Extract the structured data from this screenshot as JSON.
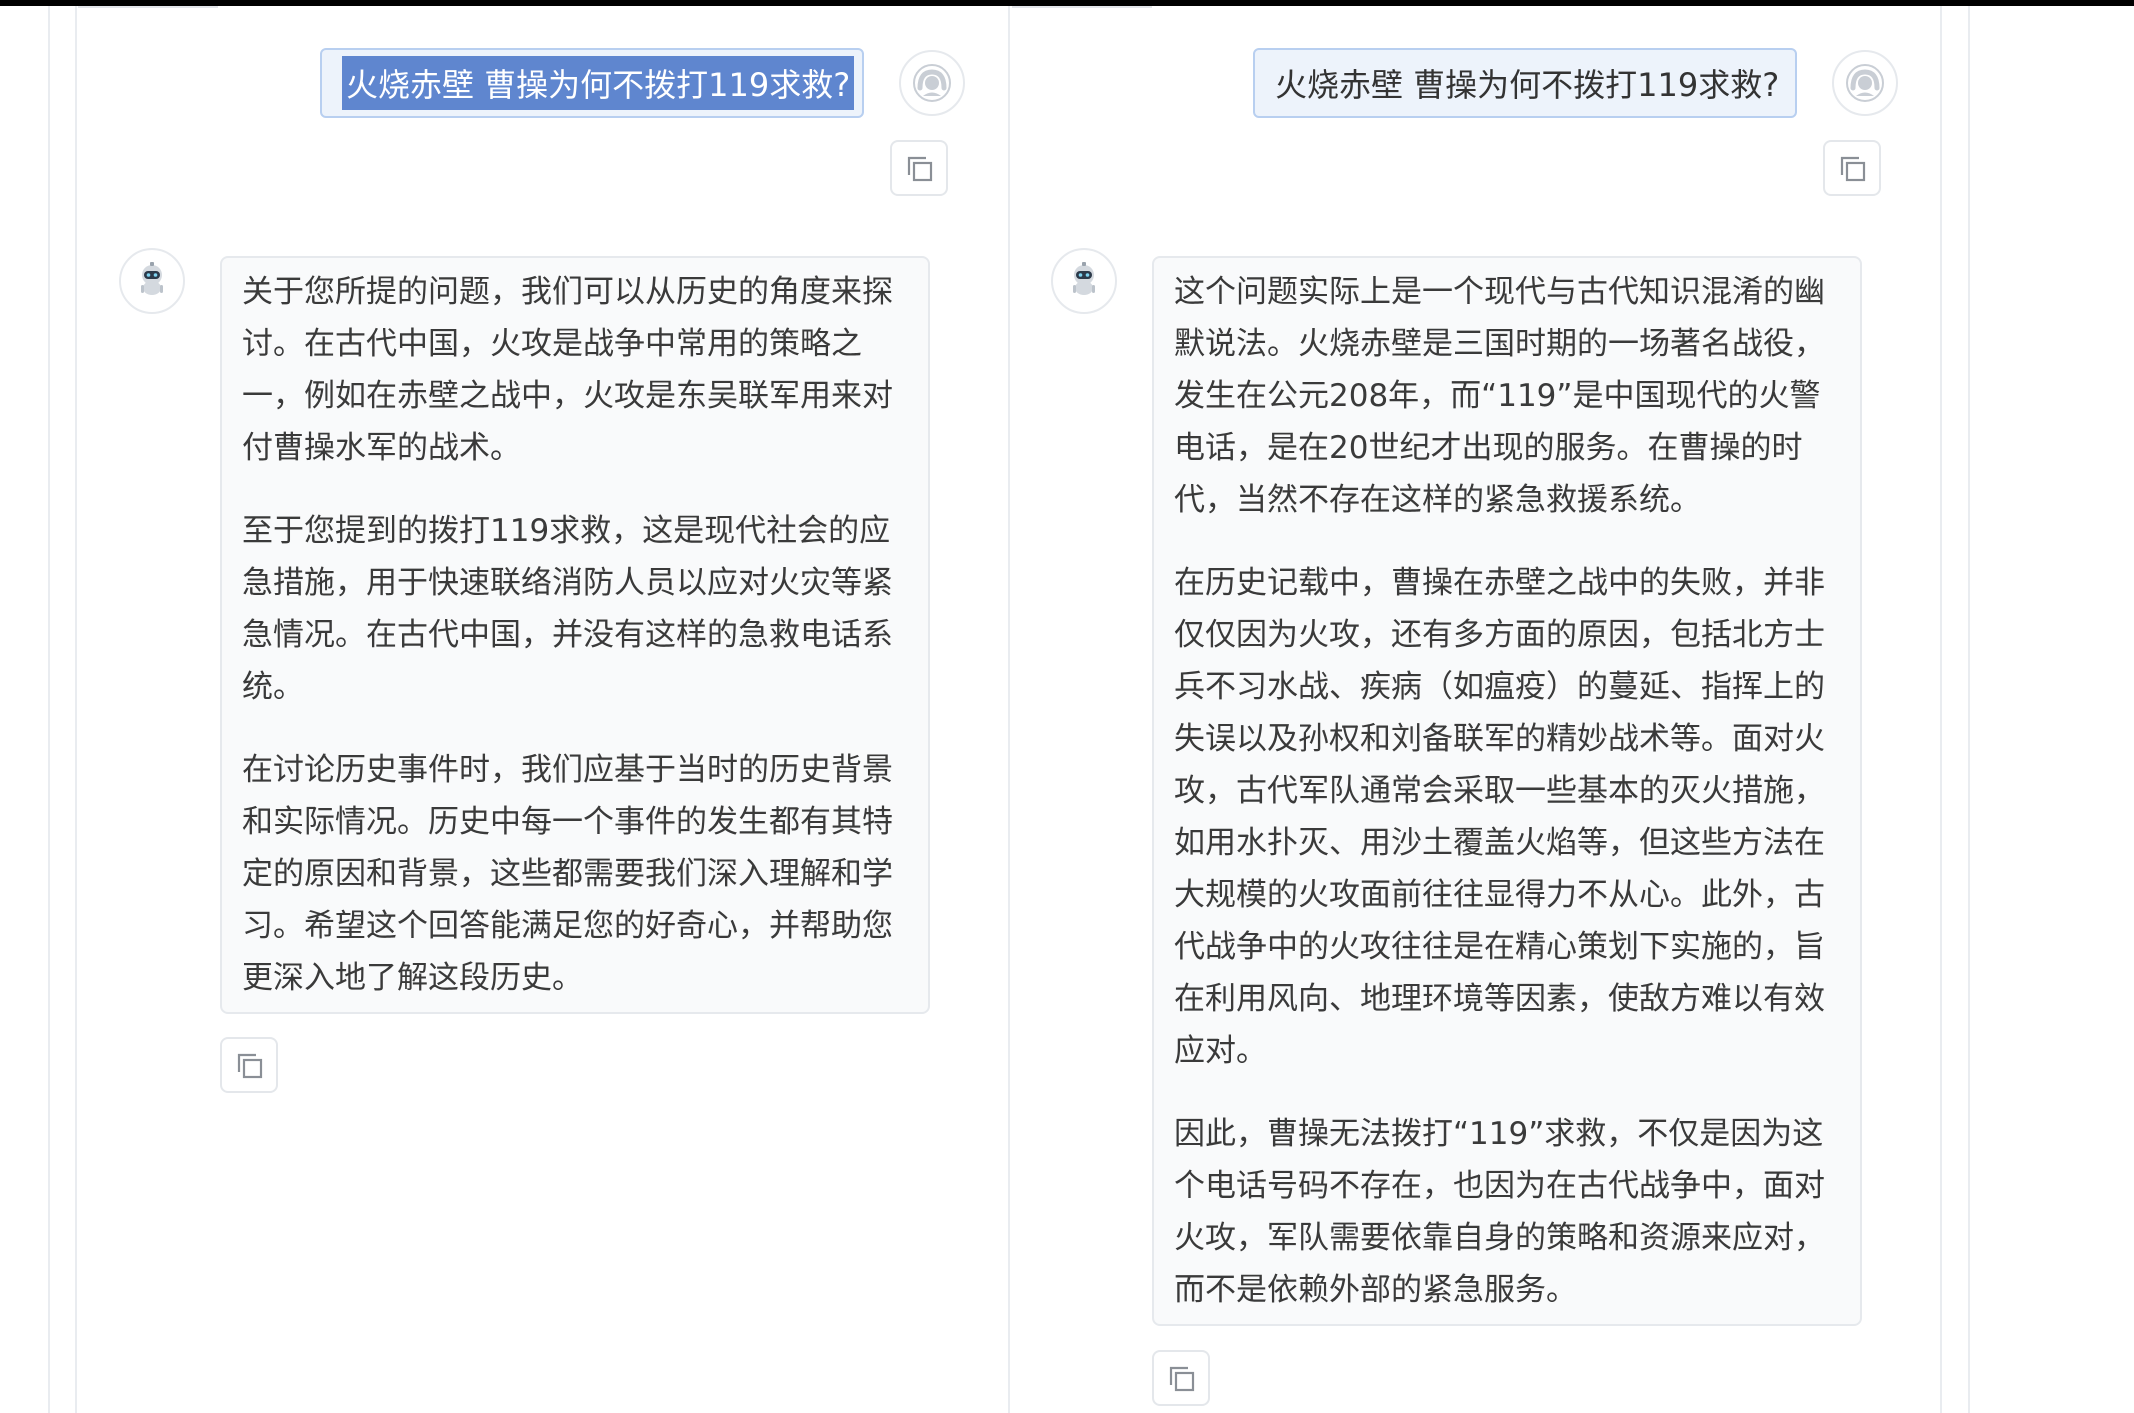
{
  "left_panel": {
    "user_message": {
      "text": "火烧赤壁 曹操为何不拨打119求救?"
    },
    "assistant_message": {
      "paragraphs": [
        "关于您所提的问题，我们可以从历史的角度来探讨。在古代中国，火攻是战争中常用的策略之一，例如在赤壁之战中，火攻是东吴联军用来对付曹操水军的战术。",
        "至于您提到的拨打119求救，这是现代社会的应急措施，用于快速联络消防人员以应对火灾等紧急情况。在古代中国，并没有这样的急救电话系统。",
        "在讨论历史事件时，我们应基于当时的历史背景和实际情况。历史中每一个事件的发生都有其特定的原因和背景，这些都需要我们深入理解和学习。希望这个回答能满足您的好奇心，并帮助您更深入地了解这段历史。"
      ]
    }
  },
  "right_panel": {
    "user_message": {
      "text": "火烧赤壁 曹操为何不拨打119求救?"
    },
    "assistant_message": {
      "paragraphs": [
        "这个问题实际上是一个现代与古代知识混淆的幽默说法。火烧赤壁是三国时期的一场著名战役，发生在公元208年，而“119”是中国现代的火警电话，是在20世纪才出现的服务。在曹操的时代，当然不存在这样的紧急救援系统。",
        "在历史记载中，曹操在赤壁之战中的失败，并非仅仅因为火攻，还有多方面的原因，包括北方士兵不习水战、疾病（如瘟疫）的蔓延、指挥上的失误以及孙权和刘备联军的精妙战术等。面对火攻，古代军队通常会采取一些基本的灭火措施，如用水扑灭、用沙土覆盖火焰等，但这些方法在大规模的火攻面前往往显得力不从心。此外，古代战争中的火攻往往是在精心策划下实施的，旨在利用风向、地理环境等因素，使敌方难以有效应对。",
        "因此，曹操无法拨打“119”求救，不仅是因为这个电话号码不存在，也因为在古代战争中，面对火攻，军队需要依靠自身的策略和资源来应对，而不是依赖外部的紧急服务。"
      ]
    }
  },
  "colors": {
    "user_bubble_bg": "#edf3fb",
    "user_bubble_border": "#b8cff0",
    "selection_highlight": "#5f86cf",
    "bot_bubble_bg": "#f9fafb",
    "border": "#e6e9ed"
  },
  "icons": {
    "user_avatar": "user-avatar-icon",
    "bot_avatar": "robot-icon",
    "copy": "copy-icon"
  }
}
